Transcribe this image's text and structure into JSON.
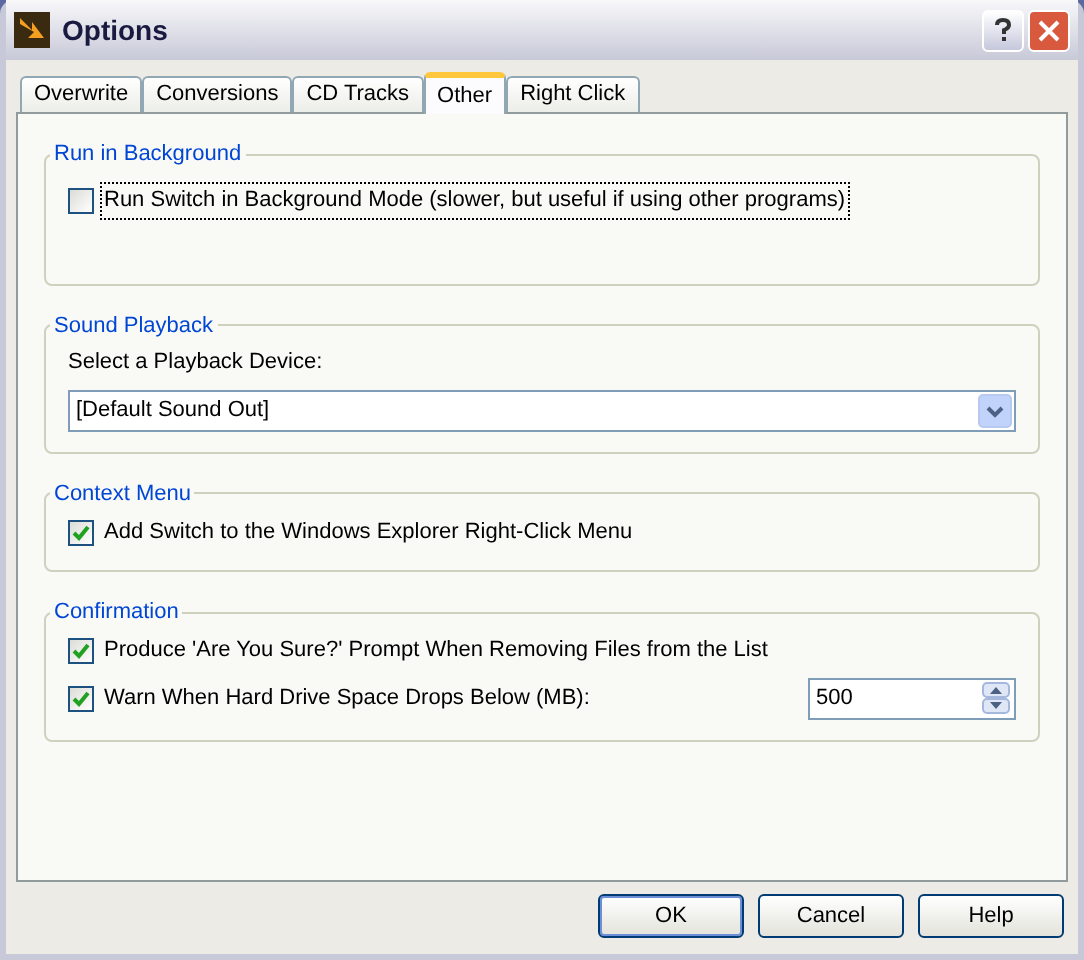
{
  "window": {
    "title": "Options"
  },
  "tabs": [
    {
      "label": "Overwrite",
      "selected": false
    },
    {
      "label": "Conversions",
      "selected": false
    },
    {
      "label": "CD Tracks",
      "selected": false
    },
    {
      "label": "Other",
      "selected": true
    },
    {
      "label": "Right Click",
      "selected": false
    }
  ],
  "groups": [
    {
      "title": "Run in Background",
      "items": [
        {
          "kind": "checkbox",
          "label": "Run Switch in Background Mode (slower, but useful if using other programs)",
          "checked": false,
          "focused": true
        }
      ]
    },
    {
      "title": "Sound Playback",
      "items": [
        {
          "kind": "select",
          "label": "Select a Playback Device:",
          "value": "[Default Sound Out]"
        }
      ]
    },
    {
      "title": "Context Menu",
      "items": [
        {
          "kind": "checkbox",
          "label": "Add Switch to the Windows Explorer Right-Click Menu",
          "checked": true,
          "focused": false
        }
      ]
    },
    {
      "title": "Confirmation",
      "items": [
        {
          "kind": "checkbox",
          "label": "Produce 'Are You Sure?' Prompt When Removing Files from the List",
          "checked": true,
          "focused": false
        },
        {
          "kind": "checkbox",
          "label": "Warn When Hard Drive Space Drops Below (MB):",
          "checked": true,
          "focused": false,
          "value": "500"
        }
      ]
    }
  ],
  "buttons": [
    "OK",
    "Cancel",
    "Help"
  ]
}
